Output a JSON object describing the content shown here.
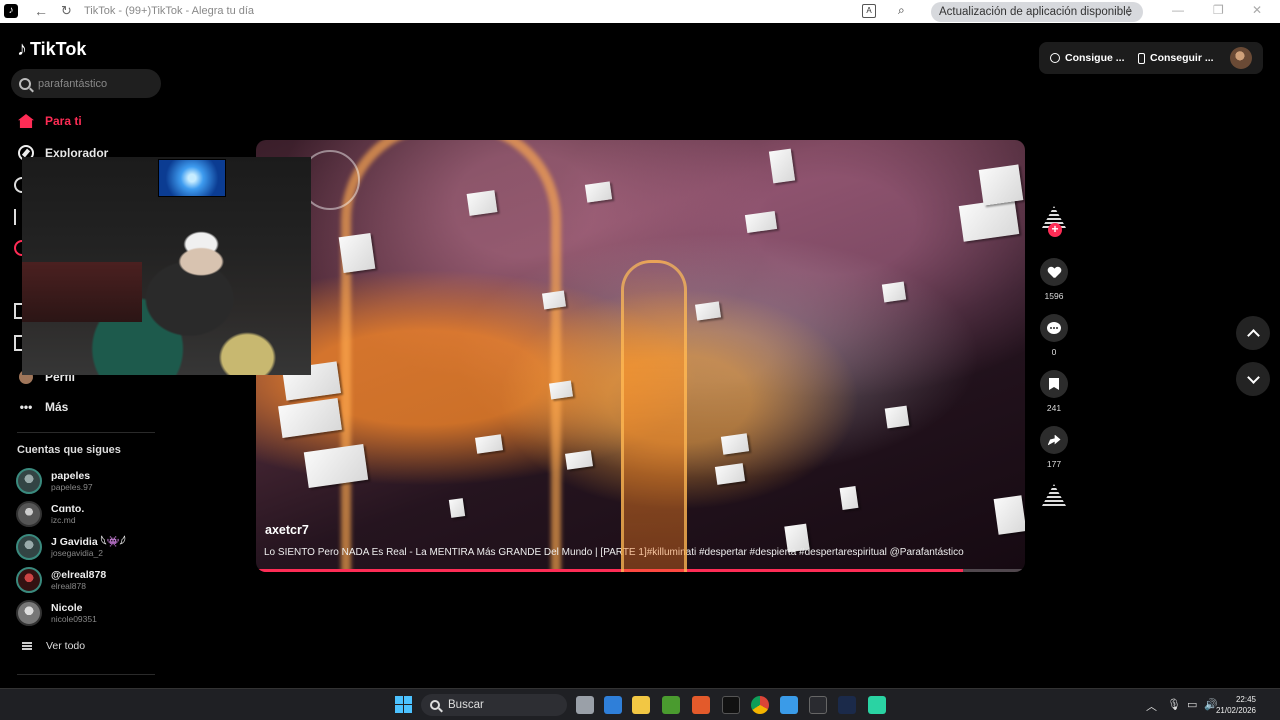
{
  "browser": {
    "title": "TikTok - (99+)TikTok - Alegra tu día",
    "update_label": "Actualización de aplicación disponible"
  },
  "sidebar": {
    "logo": "TikTok",
    "search_placeholder": "parafantástico",
    "nav": {
      "for_you": "Para ti",
      "explore": "Explorador",
      "more": "Más"
    },
    "partial_label": "Perfil",
    "following_title": "Cuentas que sigues",
    "following": [
      {
        "name": "papeles",
        "user": "papeles.97"
      },
      {
        "name": "Cɑnto.",
        "user": "izc.md"
      },
      {
        "name": "J Gavidia 𓆩👾𓆪",
        "user": "josegavidia_2"
      },
      {
        "name": "@elreal878",
        "user": "elreal878"
      },
      {
        "name": "Nicole",
        "user": "nicole09351"
      }
    ],
    "see_all": "Ver todo"
  },
  "topbar": {
    "coins": "Consigue ...",
    "app": "Conseguir ..."
  },
  "video": {
    "author": "axetcr7",
    "caption": "Lo SIENTO Pero NADA Es Real - La MENTIRA Más GRANDE Del Mundo | [PARTE 1]#killuminati #despertar #despierta #despertarespiritual @Parafantástico",
    "progress": 0.92
  },
  "actions": {
    "likes": "1596",
    "comments": "0",
    "saves": "241",
    "shares": "177"
  },
  "taskbar": {
    "search_label": "Buscar",
    "time": "22:45",
    "date": "21/02/2026"
  },
  "colors": {
    "accent": "#fe2c55",
    "taskbar": "#1f2024"
  }
}
